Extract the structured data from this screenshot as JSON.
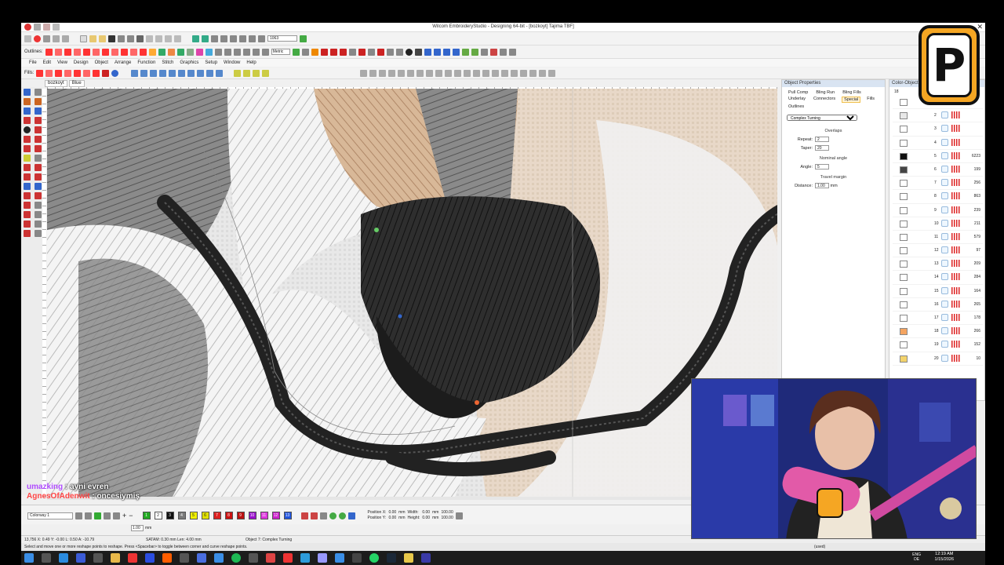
{
  "window": {
    "title": "Wilcom EmbroideryStudio - Designing 64-bit - [bozkoyt]     Tajima TBF]",
    "close_glyph": "✕"
  },
  "toolbar": {
    "outlines_label": "Outlines:",
    "zoom_value": "1063",
    "metric_label": "Metric"
  },
  "menu": [
    "File",
    "Edit",
    "View",
    "Design",
    "Object",
    "Arrange",
    "Function",
    "Stitch",
    "Graphics",
    "Setup",
    "Window",
    "Help"
  ],
  "fills_label": "Fills:",
  "doc_tabs": [
    {
      "label": "bozkoyt"
    },
    {
      "label": "Blue"
    }
  ],
  "object_properties": {
    "title": "Object Properties",
    "tabs": [
      "Pull Comp",
      "Bling Run",
      "Bling Fills",
      "Underlay",
      "Connectors",
      "Special",
      "Fills",
      "Outlines"
    ],
    "active_tab": "Special",
    "fill_type": "Complex Turning",
    "overlaps_title": "Overlaps",
    "repeat_label": "Repeat:",
    "repeat_value": "2",
    "taper_label": "Taper:",
    "taper_value": "20",
    "nominal_angle_title": "Nominal angle",
    "angle_label": "Angle:",
    "angle_value": "5",
    "travel_margin_title": "Travel margin",
    "distance_label": "Distance:",
    "distance_value": "1.00",
    "distance_unit": "mm"
  },
  "color_object_list": {
    "title": "Color-Object List",
    "header_num": "18",
    "rows": [
      {
        "num": "1",
        "swatch": "#ffffff",
        "count": ""
      },
      {
        "num": "2",
        "swatch": "#e8e8e8",
        "count": ""
      },
      {
        "num": "3",
        "swatch": "#ffffff",
        "count": ""
      },
      {
        "num": "4",
        "swatch": "#ffffff",
        "count": ""
      },
      {
        "num": "5",
        "swatch": "#111111",
        "count": "6223"
      },
      {
        "num": "6",
        "swatch": "#444444",
        "count": "199"
      },
      {
        "num": "7",
        "swatch": "#ffffff",
        "count": "256"
      },
      {
        "num": "8",
        "swatch": "#ffffff",
        "count": "863"
      },
      {
        "num": "9",
        "swatch": "#ffffff",
        "count": "239"
      },
      {
        "num": "10",
        "swatch": "#ffffff",
        "count": "211"
      },
      {
        "num": "11",
        "swatch": "#ffffff",
        "count": "579"
      },
      {
        "num": "12",
        "swatch": "#ffffff",
        "count": "97"
      },
      {
        "num": "13",
        "swatch": "#ffffff",
        "count": "209"
      },
      {
        "num": "14",
        "swatch": "#ffffff",
        "count": "284"
      },
      {
        "num": "15",
        "swatch": "#ffffff",
        "count": "164"
      },
      {
        "num": "16",
        "swatch": "#ffffff",
        "count": "265"
      },
      {
        "num": "17",
        "swatch": "#ffffff",
        "count": "178"
      },
      {
        "num": "18",
        "swatch": "#f4a460",
        "count": "266"
      },
      {
        "num": "19",
        "swatch": "#ffffff",
        "count": "152"
      },
      {
        "num": "20",
        "swatch": "#f3d36b",
        "count": "10"
      }
    ]
  },
  "chat": [
    {
      "user": "umazking",
      "message": "ayni evren"
    },
    {
      "user": "AgnesOfAdenwit",
      "message": "oncesiymiş"
    }
  ],
  "palette": {
    "colorway": "Colorway 1",
    "stitch_length": "1.00",
    "stitch_unit": "mm",
    "swatches": [
      {
        "label": "1",
        "color": "#22aa22"
      },
      {
        "label": "2",
        "color": "#ffffff"
      },
      {
        "label": "3",
        "color": "#111111"
      },
      {
        "label": "4",
        "color": "#7a7a7a"
      },
      {
        "label": "5",
        "color": "#f0f000"
      },
      {
        "label": "6",
        "color": "#e0e000"
      },
      {
        "label": "7",
        "color": "#dd2222"
      },
      {
        "label": "8",
        "color": "#cc1111"
      },
      {
        "label": "9",
        "color": "#bb1111"
      },
      {
        "label": "10",
        "color": "#9911cc"
      },
      {
        "label": "11",
        "color": "#dd33dd"
      },
      {
        "label": "12",
        "color": "#cc22cc"
      },
      {
        "label": "13",
        "color": "#2255dd"
      }
    ],
    "position_x_label": "Position X:",
    "position_y_label": "Position Y:",
    "position_x": "0.00",
    "position_y": "0.00",
    "width_label": "Width:",
    "height_label": "Height:",
    "width": "0.00",
    "height": "0.00",
    "width_pct": "100.00",
    "height_pct": "100.00",
    "unit": "mm"
  },
  "status": {
    "line1_left": "13,756     X: 0.49 Y: -0.00 L: 0.50 A: -10.79",
    "line1_mid": "SATAM: 0.30 mm Len: 4.00 mm",
    "line1_obj": "Object 7: Complex Turning",
    "line2": "Select and move one or more reshape points to reshape. Press <Spacebar> to toggle between corner and curve reshape points.",
    "line2_right": "(used)"
  },
  "taskbar": {
    "lang1": "ENG",
    "lang2": "DE",
    "time": "12:19 AM",
    "date": "1/15/2026"
  },
  "logo_letter": "P"
}
